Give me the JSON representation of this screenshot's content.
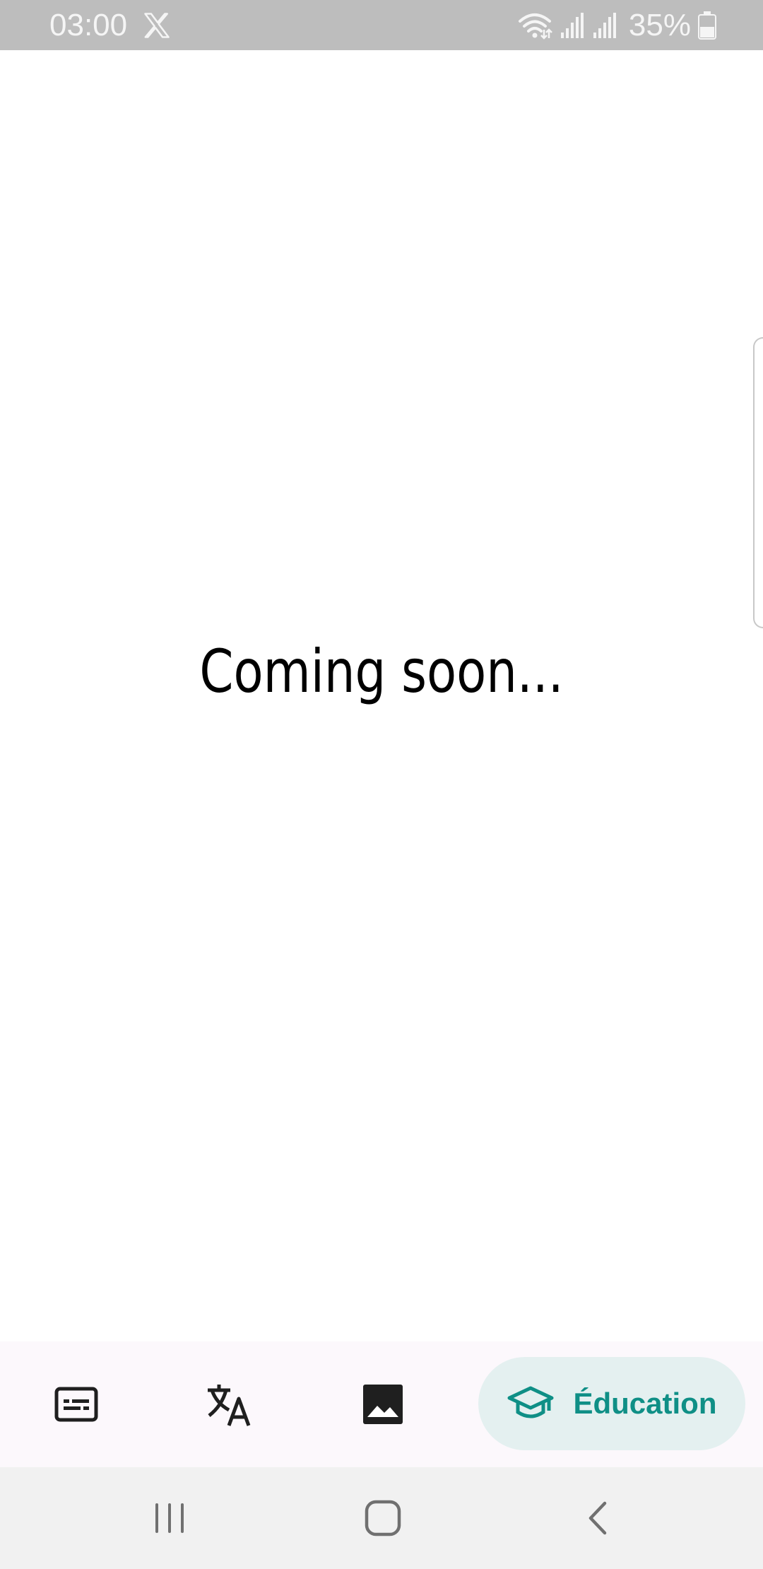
{
  "status_bar": {
    "time": "03:00",
    "battery_percent": "35%",
    "icons": [
      "x-icon",
      "wifi-icon",
      "signal-icon",
      "signal-icon",
      "battery-icon"
    ]
  },
  "main": {
    "message": "Coming soon..."
  },
  "bottom_nav": {
    "items": [
      {
        "icon": "captions-icon",
        "label": ""
      },
      {
        "icon": "translate-icon",
        "label": ""
      },
      {
        "icon": "image-icon",
        "label": ""
      },
      {
        "icon": "graduation-cap-icon",
        "label": "Éducation",
        "selected": true
      }
    ],
    "accent_color": "#0f8f86",
    "pill_color": "#e4f0f0"
  },
  "system_nav": {
    "buttons": [
      "recents-icon",
      "home-icon",
      "back-icon"
    ]
  }
}
